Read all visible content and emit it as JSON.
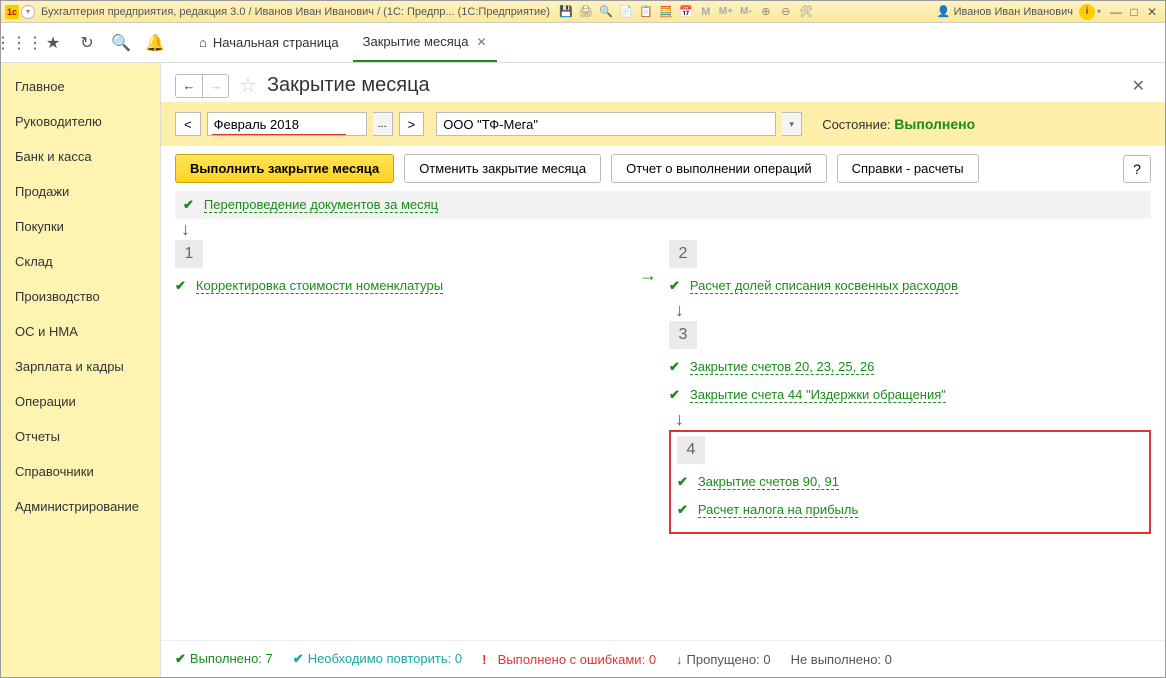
{
  "titlebar": {
    "title": "Бухгалтерия предприятия, редакция 3.0 / Иванов Иван Иванович / (1С: Предпр...   (1С:Предприятие)",
    "user": "Иванов Иван Иванович"
  },
  "tabs": {
    "home": "Начальная страница",
    "active": "Закрытие месяца"
  },
  "sidebar": {
    "items": [
      "Главное",
      "Руководителю",
      "Банк и касса",
      "Продажи",
      "Покупки",
      "Склад",
      "Производство",
      "ОС и НМА",
      "Зарплата и кадры",
      "Операции",
      "Отчеты",
      "Справочники",
      "Администрирование"
    ]
  },
  "page": {
    "title": "Закрытие месяца",
    "period": "Февраль 2018",
    "org": "ООО \"ТФ-Мега\"",
    "state_label": "Состояние:",
    "state_value": "Выполнено"
  },
  "buttons": {
    "run": "Выполнить закрытие месяца",
    "cancel": "Отменить закрытие месяца",
    "report": "Отчет о выполнении операций",
    "refs": "Справки - расчеты",
    "help": "?"
  },
  "ops": {
    "reprov": "Перепроведение документов за месяц",
    "stage1": {
      "num": "1",
      "op1": "Корректировка стоимости номенклатуры"
    },
    "stage2": {
      "num": "2",
      "op1": "Расчет долей списания косвенных расходов"
    },
    "stage3": {
      "num": "3",
      "op1": "Закрытие счетов 20, 23, 25, 26",
      "op2": "Закрытие счета 44 \"Издержки обращения\""
    },
    "stage4": {
      "num": "4",
      "op1": "Закрытие счетов 90, 91",
      "op2": "Расчет налога на прибыль"
    }
  },
  "status": {
    "done_label": "Выполнено:",
    "done": "7",
    "repeat_label": "Необходимо повторить:",
    "repeat": "0",
    "err_label": "Выполнено с ошибками:",
    "err": "0",
    "skip_label": "Пропущено:",
    "skip": "0",
    "notdone_label": "Не выполнено:",
    "notdone": "0"
  }
}
